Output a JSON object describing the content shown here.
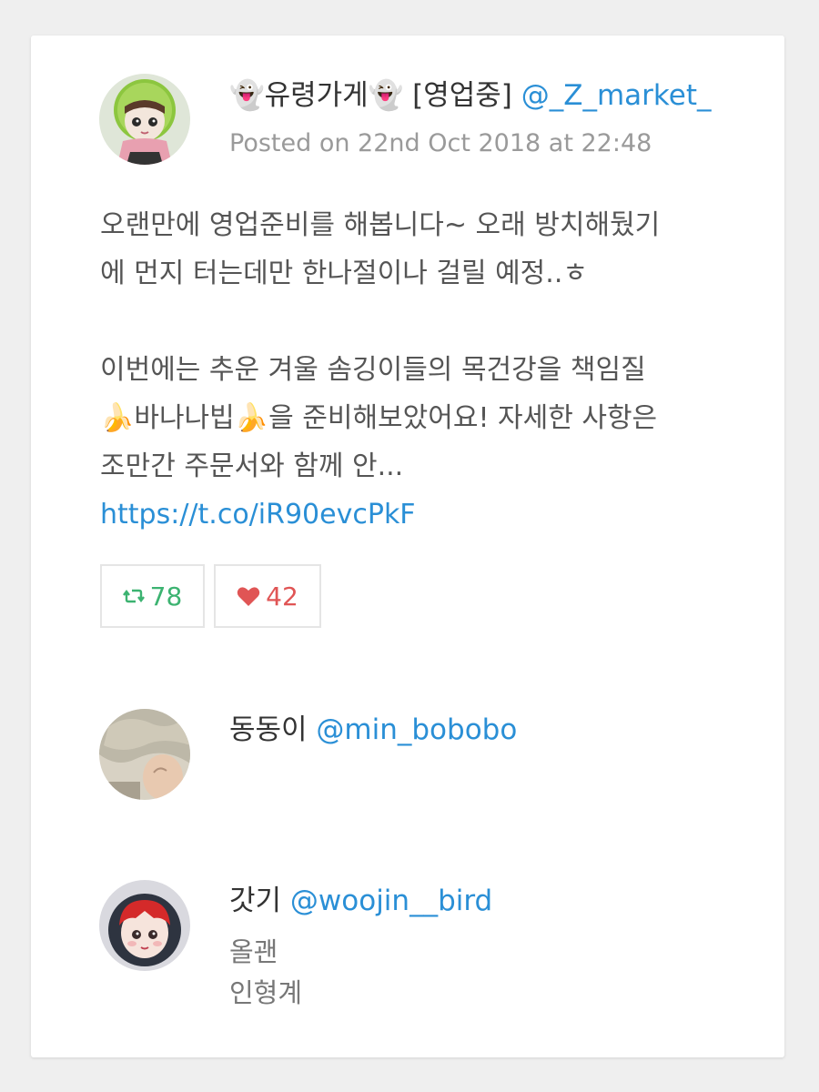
{
  "post": {
    "author_name": "👻유령가게👻 [영업중]",
    "author_handle": "@_Z_market_",
    "posted": "Posted on 22nd Oct 2018 at 22:48",
    "body_line1": "오랜만에 영업준비를 해봅니다~ 오래 방치해뒀기",
    "body_line2": "에 먼지 터는데만 한나절이나 걸릴 예정..ㅎ",
    "body_line3": "이번에는 추운 겨울 솜깅이들의 목건강을 책임질",
    "body_line4": "🍌바나나빕🍌을 준비해보았어요! 자세한 사항은",
    "body_line5": "조만간 주문서와 함께 안...",
    "link": "https://t.co/iR90evcPkF",
    "retweets": "78",
    "likes": "42",
    "retweet_icon": "retweet-icon",
    "like_icon": "heart-icon"
  },
  "replies": [
    {
      "name": "동동이",
      "handle": "@min_bobobo"
    },
    {
      "name": "갓기",
      "handle": "@woojin__bird",
      "text_line1": "올괜",
      "text_line2": "인형계"
    }
  ],
  "colors": {
    "link": "#2a8fd6",
    "retweet": "#3cb371",
    "like": "#e05555",
    "meta": "#9a9a9a"
  }
}
